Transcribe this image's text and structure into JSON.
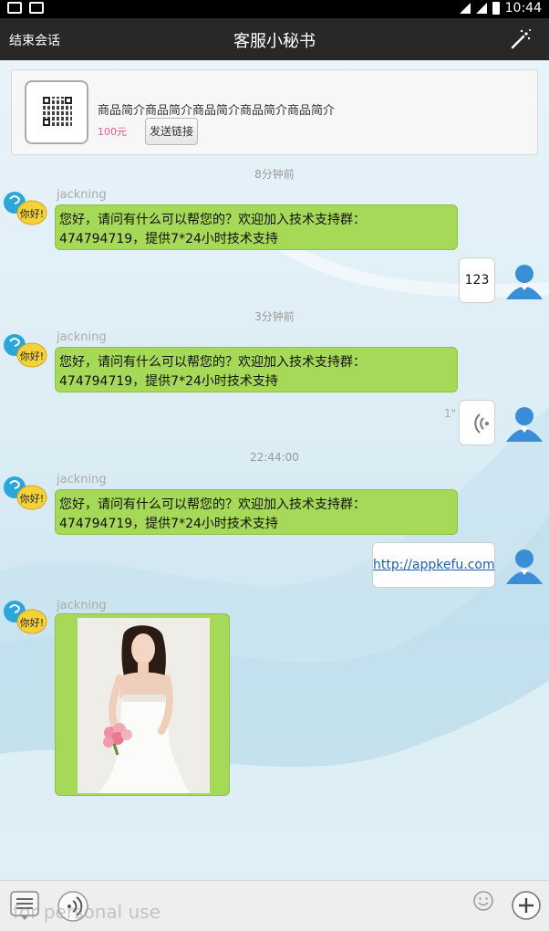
{
  "status_bar": {
    "time": "10:44"
  },
  "title_bar": {
    "end_session": "结束会话",
    "title": "客服小秘书"
  },
  "product": {
    "name": "商品简介商品简介商品简介商品简介商品简介",
    "price": "100元",
    "send_link": "发送链接"
  },
  "messages": [
    {
      "time": "8分钟前",
      "sender": "jackning",
      "badge": "你好!",
      "text_line1": "您好，请问有什么可以帮您的？欢迎加入技术支持群：",
      "text_line2": "474794719，提供7*24小时技术支持"
    },
    {
      "user_text": "123"
    },
    {
      "time": "3分钟前",
      "sender": "jackning",
      "badge": "你好!",
      "text_line1": "您好，请问有什么可以帮您的？欢迎加入技术支持群：",
      "text_line2": "474794719，提供7*24小时技术支持"
    },
    {
      "voice_length": "1\""
    },
    {
      "time": "22:44:00",
      "sender": "jackning",
      "badge": "你好!",
      "text_line1": "您好，请问有什么可以帮您的？欢迎加入技术支持群：",
      "text_line2": "474794719，提供7*24小时技术支持"
    },
    {
      "link": "http://appkefu.com"
    },
    {
      "sender": "jackning",
      "badge": "你好!"
    }
  ],
  "input": {
    "watermark": "for personal use"
  }
}
